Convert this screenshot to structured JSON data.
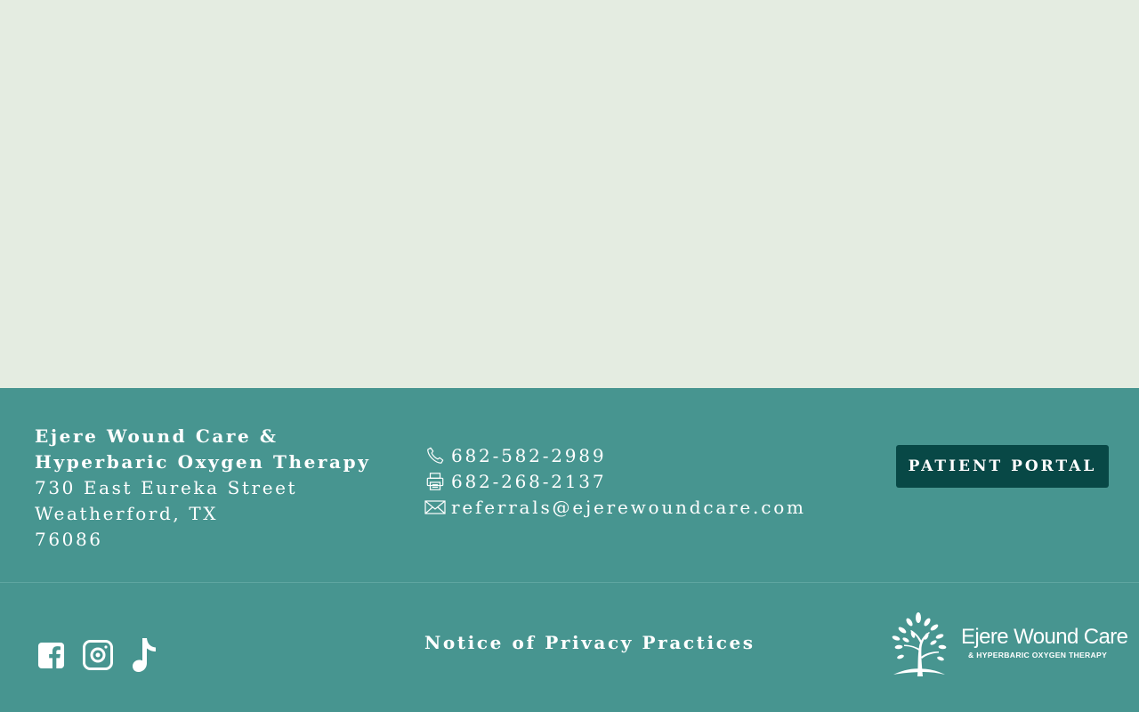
{
  "footer": {
    "address": {
      "name_line1": "Ejere Wound Care &",
      "name_line2": "Hyperbaric Oxygen Therapy",
      "street": "730 East Eureka Street",
      "city_state": "Weatherford, TX",
      "zip": "76086"
    },
    "contact": {
      "phone": "682-582-2989",
      "fax": "682-268-2137",
      "email": "referrals@ejerewoundcare.com",
      "icons": [
        "phone-icon",
        "fax-icon",
        "mail-icon"
      ]
    },
    "patient_portal_label": "PATIENT PORTAL",
    "privacy_link": "Notice of Privacy Practices",
    "socials": [
      "facebook-icon",
      "instagram-icon",
      "tiktok-icon"
    ],
    "logo": {
      "brand": "Ejere Wound Care",
      "tagline": "& HYPERBARIC OXYGEN THERAPY"
    }
  },
  "colors": {
    "hero_bg": "#e4ece1",
    "footer_bg": "#479590",
    "button_bg": "#084846",
    "text": "#ffffff"
  }
}
